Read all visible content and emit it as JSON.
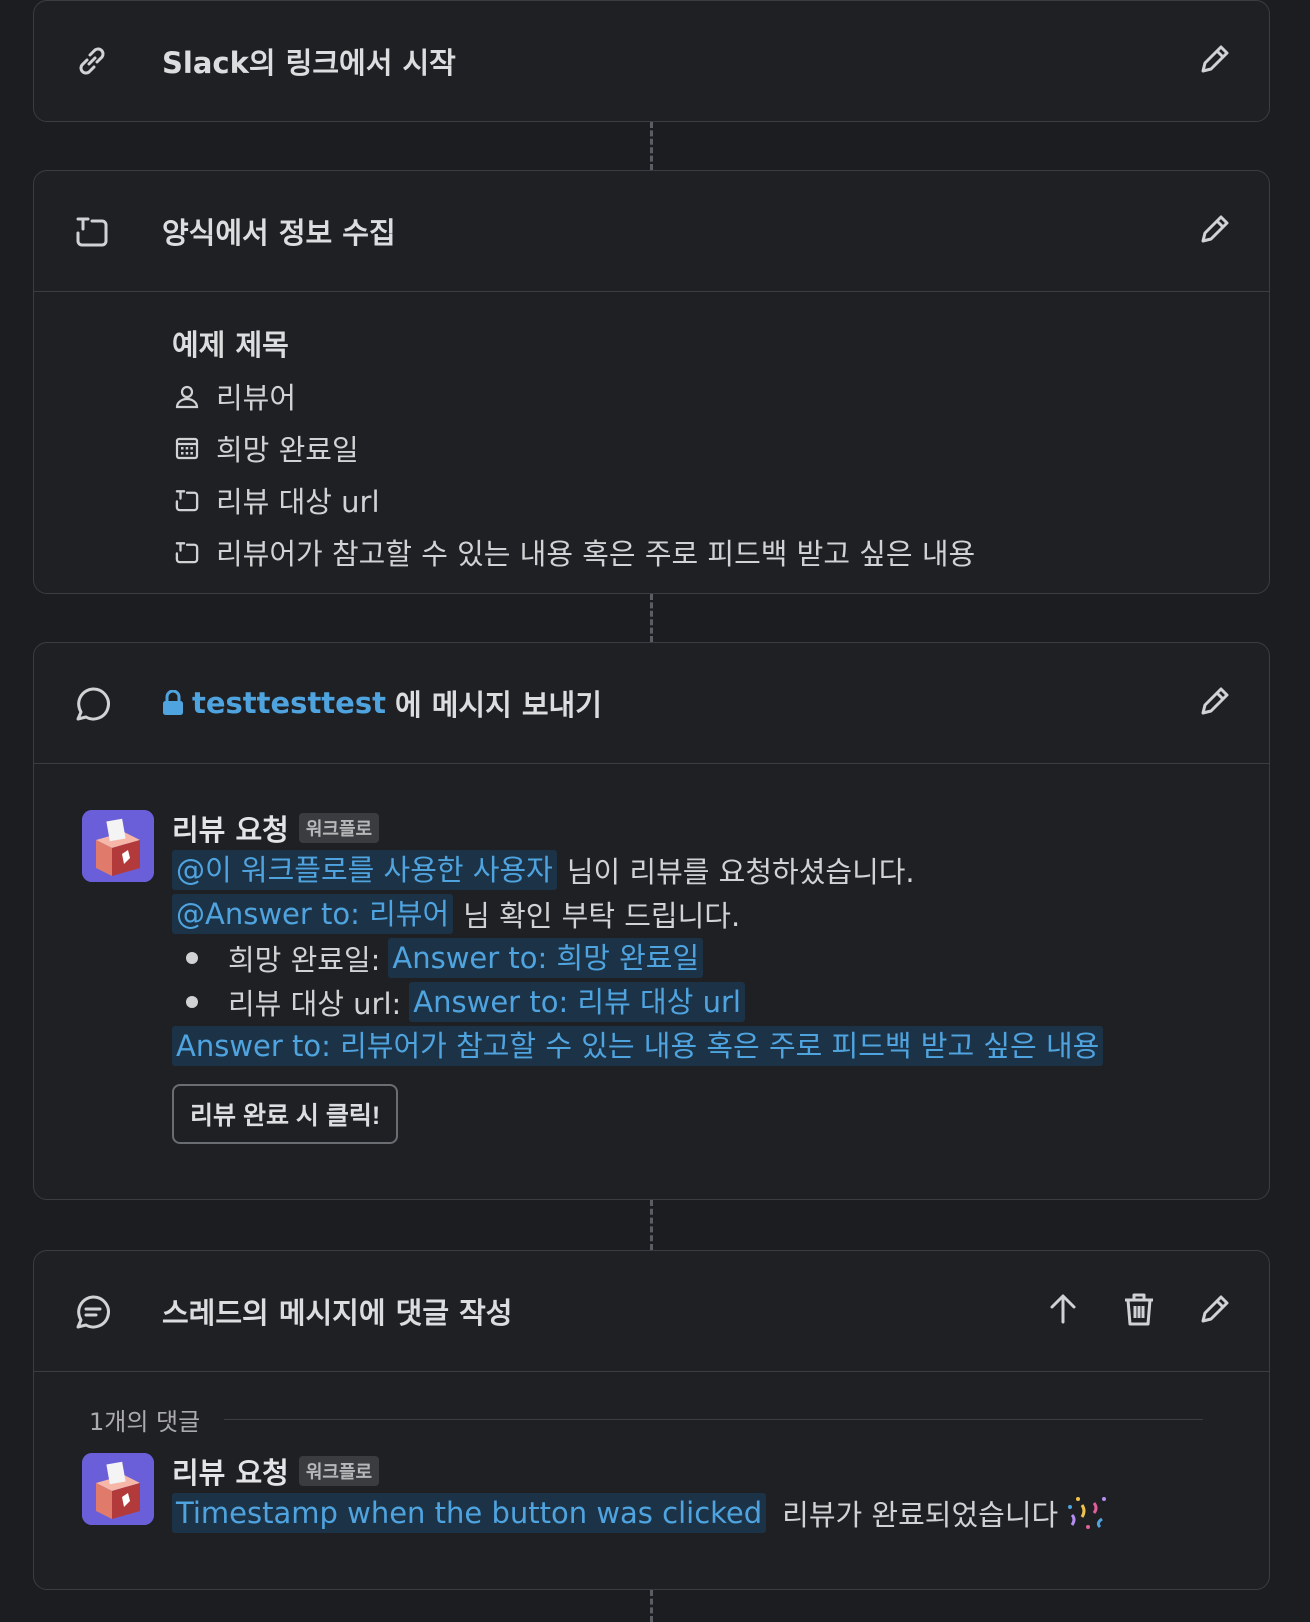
{
  "steps": {
    "trigger": {
      "title": "Slack의 링크에서 시작"
    },
    "form": {
      "title": "양식에서 정보 수집",
      "form_title": "예제 제목",
      "fields": [
        {
          "icon": "person-icon",
          "label": "리뷰어"
        },
        {
          "icon": "calendar-icon",
          "label": "희망 완료일"
        },
        {
          "icon": "text-field-icon",
          "label": "리뷰 대상 url"
        },
        {
          "icon": "text-field-icon",
          "label": "리뷰어가 참고할 수 있는 내용 혹은 주로 피드백 받고 싶은 내용"
        }
      ]
    },
    "send_message": {
      "channel": "testtesttest",
      "title_suffix": "에 메시지 보내기",
      "message": {
        "sender": "리뷰 요청",
        "badge": "워크플로",
        "line1_mention": "@이 워크플로를 사용한 사용자",
        "line1_text": "님이 리뷰를 요청하셨습니다.",
        "line2_mention": "@Answer to: 리뷰어",
        "line2_text": "님 확인 부탁 드립니다.",
        "bullet1_label": "희망 완료일:",
        "bullet1_value": "Answer to: 희망 완료일",
        "bullet2_label": "리뷰 대상 url:",
        "bullet2_value": "Answer to: 리뷰 대상 url",
        "line5_mention": "Answer to: 리뷰어가 참고할 수 있는 내용 혹은 주로 피드백 받고 싶은 내용",
        "button_label": "리뷰 완료 시 클릭!"
      }
    },
    "thread_reply": {
      "title": "스레드의 메시지에 댓글 작성",
      "reply_count": "1개의 댓글",
      "message": {
        "sender": "리뷰 요청",
        "badge": "워크플로",
        "mention": "Timestamp when the button was clicked",
        "text": "리뷰가 완료되었습니다"
      }
    }
  },
  "colors": {
    "background": "#1b1d21",
    "card": "#1e2024",
    "mention_text": "#4fa4e0",
    "mention_bg": "#1c3347",
    "avatar": "#6a5fd8"
  }
}
